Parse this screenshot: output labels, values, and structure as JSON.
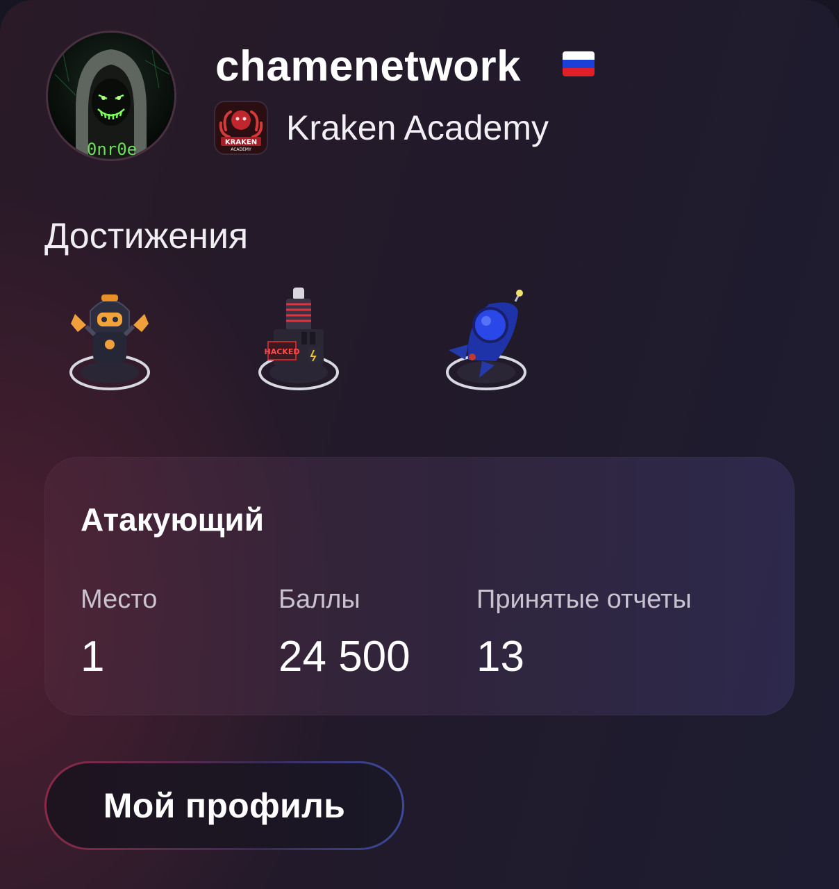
{
  "profile": {
    "username": "chamenetwork",
    "country_flag": "Russia",
    "avatar_text": "0nr0e",
    "team_name": "Kraken Academy",
    "team_logo_text": "KRAKEN",
    "team_logo_subtext": "ACADEMY"
  },
  "achievements": {
    "title": "Достижения",
    "items": [
      {
        "icon": "robot-achievement-icon"
      },
      {
        "icon": "hacked-tower-achievement-icon"
      },
      {
        "icon": "rocket-achievement-icon"
      }
    ]
  },
  "stats": {
    "title": "Атакующий",
    "place_label": "Место",
    "place_value": "1",
    "points_label": "Баллы",
    "points_value": "24 500",
    "reports_label": "Принятые отчеты",
    "reports_value": "13"
  },
  "actions": {
    "profile_button": "Мой профиль"
  },
  "colors": {
    "background": "#171521",
    "accent_red": "#8a2a44",
    "accent_blue": "#3b4a9a",
    "flag_white": "#ffffff",
    "flag_blue": "#1c3fd8",
    "flag_red": "#e01f26"
  }
}
